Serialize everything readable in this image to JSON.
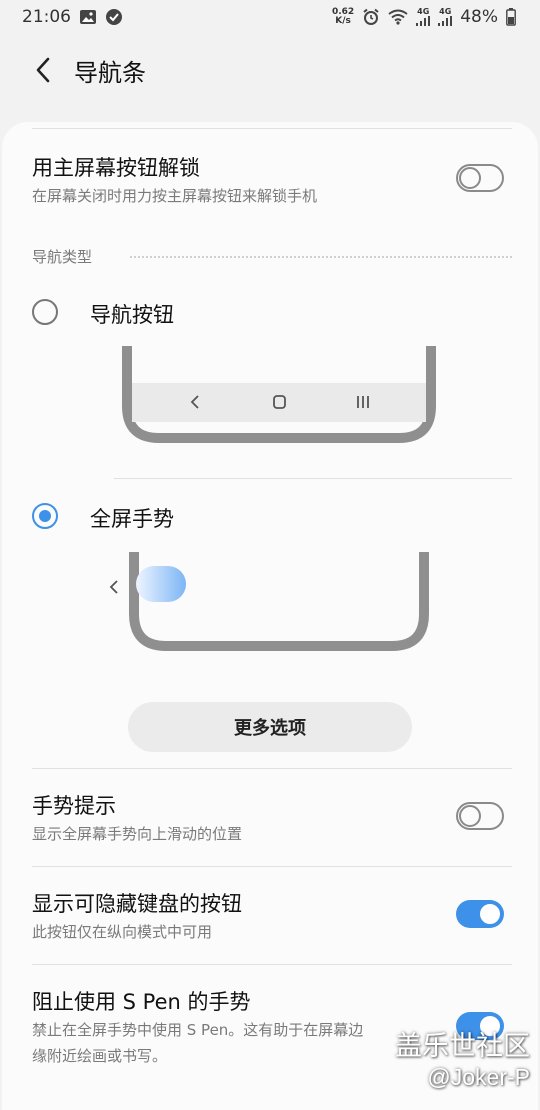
{
  "status_bar": {
    "time": "21:06",
    "net_speed_value": "0.62",
    "net_speed_unit": "K/s",
    "signal1": "4G",
    "signal2": "4G",
    "battery": "48%"
  },
  "header": {
    "title": "导航条"
  },
  "unlock_row": {
    "title": "用主屏幕按钮解锁",
    "subtitle": "在屏幕关闭时用力按主屏幕按钮来解锁手机",
    "enabled": false
  },
  "nav_type": {
    "section_label": "导航类型",
    "options": [
      {
        "label": "导航按钮",
        "selected": false
      },
      {
        "label": "全屏手势",
        "selected": true
      }
    ],
    "more_options_label": "更多选项"
  },
  "gesture_hint_row": {
    "title": "手势提示",
    "subtitle": "显示全屏幕手势向上滑动的位置",
    "enabled": false
  },
  "hide_keyboard_row": {
    "title": "显示可隐藏键盘的按钮",
    "subtitle": "此按钮仅在纵向模式中可用",
    "enabled": true
  },
  "spen_row": {
    "title": "阻止使用 S Pen 的手势",
    "subtitle_line1": "禁止在全屏手势中使用 S Pen。这有助于在屏幕边",
    "subtitle_line2": "缘附近绘画或书写。",
    "enabled": true
  },
  "watermark": {
    "line1": "盖乐世社区",
    "line2": "@Joker-P"
  },
  "colors": {
    "accent": "#3e91e8",
    "background": "#f2f2f2",
    "card": "#fbfbfb"
  }
}
